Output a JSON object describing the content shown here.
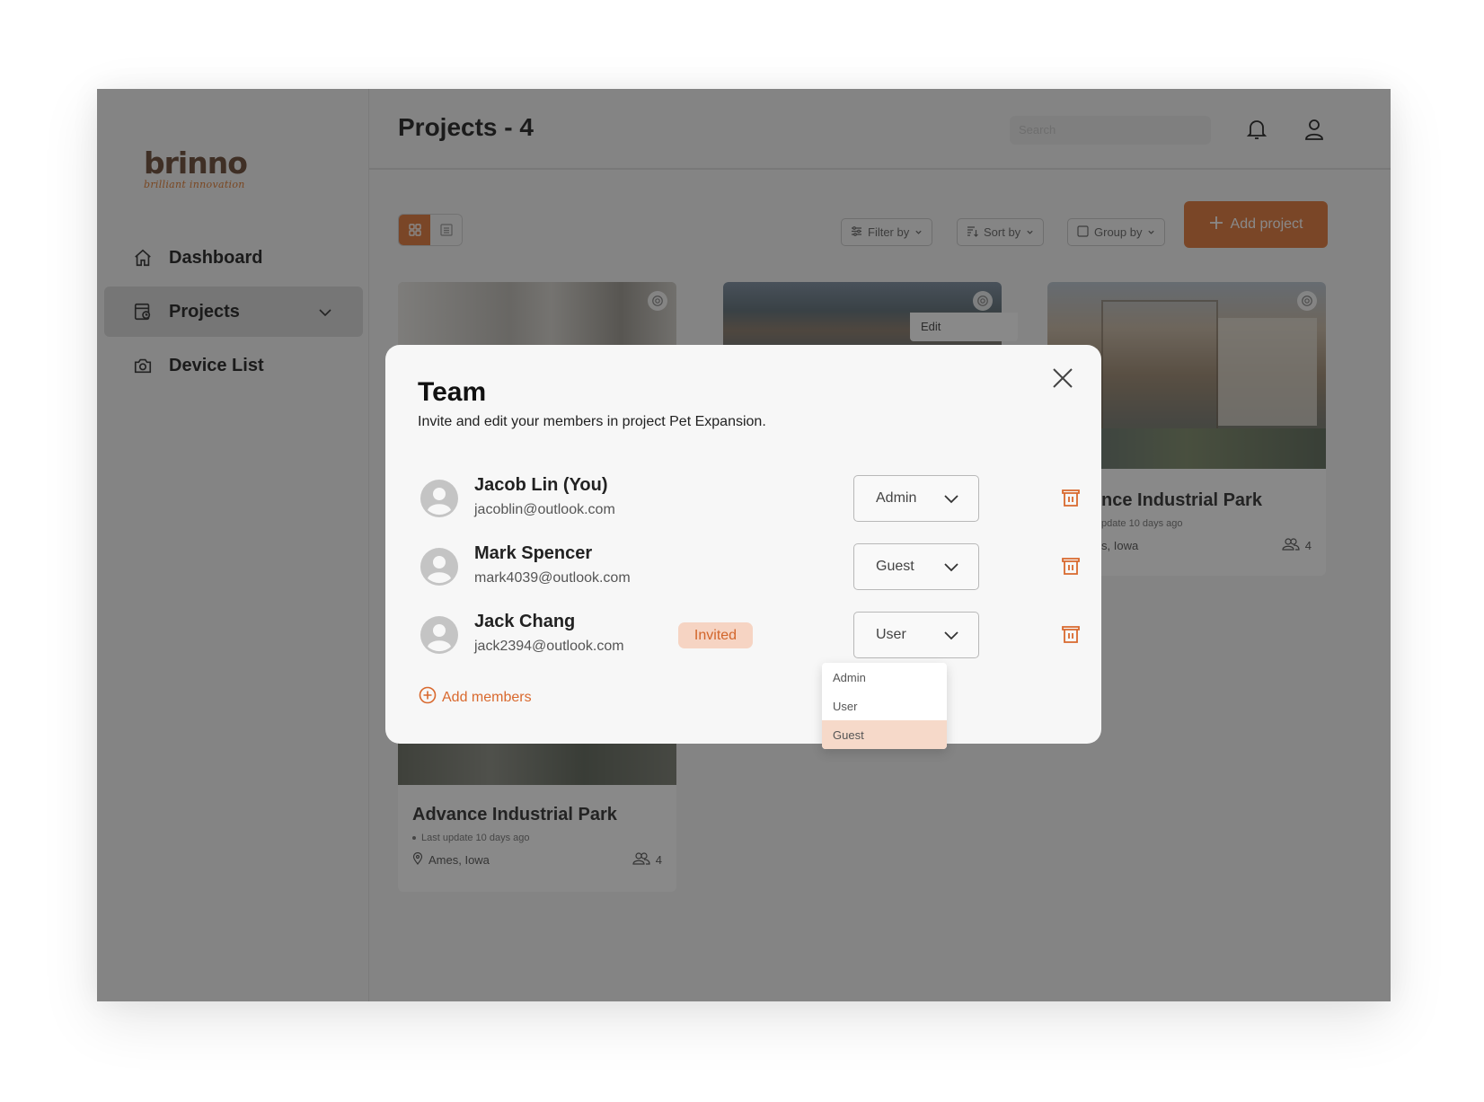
{
  "brand": {
    "wordmark": "brinno",
    "tagline": "brilliant innovation",
    "accent": "#e0783a"
  },
  "sidebar": {
    "items": [
      {
        "label": "Dashboard",
        "icon": "home-icon",
        "active": false
      },
      {
        "label": "Projects",
        "icon": "projects-icon",
        "active": true,
        "expandable": true
      },
      {
        "label": "Device List",
        "icon": "camera-icon",
        "active": false
      }
    ]
  },
  "header": {
    "title": "Projects - 4",
    "search_placeholder": "Search"
  },
  "toolbar": {
    "filter_label": "Filter by",
    "sort_label": "Sort by",
    "group_label": "Group by",
    "add_label": "Add project"
  },
  "cards": [
    {
      "title": "Advance Industrial Park",
      "updated": "Last update 10 days ago",
      "location": "Ames, Iowa",
      "members": "4"
    },
    {
      "title": "",
      "updated": "",
      "location": "",
      "members": ""
    },
    {
      "title": "nce Industrial Park",
      "updated": "pdate 10 days ago",
      "location": "s, Iowa",
      "members": "4"
    }
  ],
  "edit_popover": "Edit",
  "modal": {
    "title": "Team",
    "subtitle": "Invite and edit your members in project Pet Expansion.",
    "members": [
      {
        "name": "Jacob Lin (You)",
        "email": "jacoblin@outlook.com",
        "role": "Admin",
        "badge": ""
      },
      {
        "name": "Mark Spencer",
        "email": "mark4039@outlook.com",
        "role": "Guest",
        "badge": ""
      },
      {
        "name": "Jack Chang",
        "email": "jack2394@outlook.com",
        "role": "User",
        "badge": "Invited"
      }
    ],
    "add_members_label": "Add members"
  },
  "role_dropdown": {
    "options": [
      "Admin",
      "User",
      "Guest"
    ],
    "highlighted": "Guest"
  }
}
